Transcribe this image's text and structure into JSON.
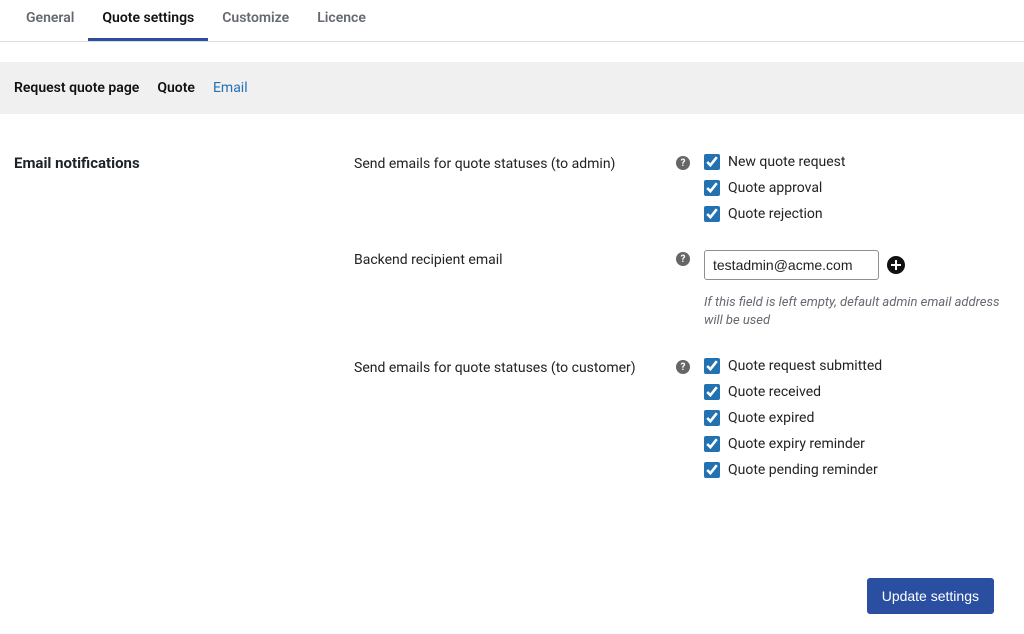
{
  "topTabs": {
    "general": "General",
    "quoteSettings": "Quote settings",
    "customize": "Customize",
    "licence": "Licence"
  },
  "subNav": {
    "requestQuotePage": "Request quote page",
    "quote": "Quote",
    "email": "Email"
  },
  "section": {
    "title": "Email notifications"
  },
  "admin": {
    "label": "Send emails for quote statuses (to admin)",
    "options": {
      "newRequest": "New quote request",
      "approval": "Quote approval",
      "rejection": "Quote rejection"
    }
  },
  "recipient": {
    "label": "Backend recipient email",
    "value": "testadmin@acme.com",
    "hint": "If this field is left empty, default admin email address will be used"
  },
  "customer": {
    "label": "Send emails for quote statuses (to customer)",
    "options": {
      "submitted": "Quote request submitted",
      "received": "Quote received",
      "expired": "Quote expired",
      "expiryReminder": "Quote expiry reminder",
      "pendingReminder": "Quote pending reminder"
    }
  },
  "buttons": {
    "update": "Update settings"
  }
}
